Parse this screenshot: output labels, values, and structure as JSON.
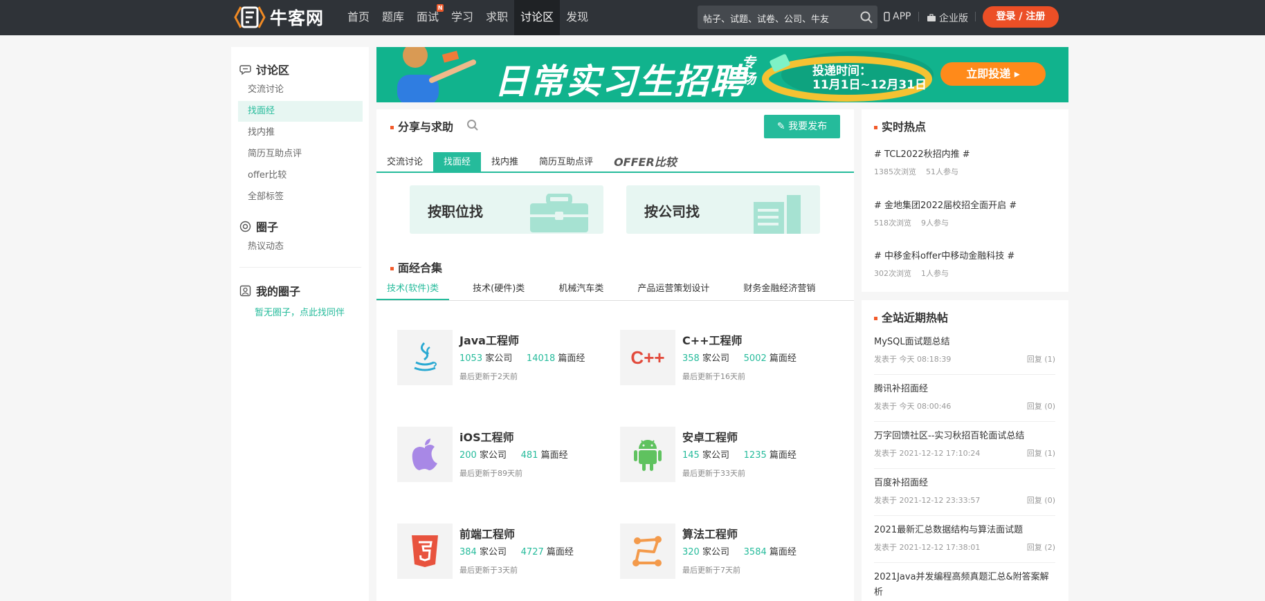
{
  "header": {
    "logo_text": "牛客网",
    "nav": [
      {
        "label": "首页"
      },
      {
        "label": "题库"
      },
      {
        "label": "面试",
        "badge": "N"
      },
      {
        "label": "学习"
      },
      {
        "label": "求职"
      },
      {
        "label": "讨论区"
      },
      {
        "label": "发现"
      }
    ],
    "search_placeholder": "帖子、试题、试卷、公司、牛友",
    "app_label": "APP",
    "enterprise_label": "企业版",
    "login_label": "登录 / 注册",
    "colors": {
      "bar": "#2f3338",
      "login": "#ec4f26",
      "accent": "#25bb9b"
    }
  },
  "sidebar": {
    "discussion_title": "讨论区",
    "discussion_items": [
      "交流讨论",
      "找面经",
      "找内推",
      "简历互助点评",
      "offer比较",
      "全部标签"
    ],
    "active_item": "找面经",
    "circle_title": "圈子",
    "circle_items": [
      "热议动态"
    ],
    "my_circle_title": "我的圈子",
    "my_circle_link": "暂无圈子，点此找同伴"
  },
  "banner": {
    "title": "日常实习生招聘",
    "suffix": "专场",
    "time_label": "投递时间：",
    "time_range": "11月1日~12月31日",
    "button": "立即投递 ▸"
  },
  "main": {
    "title": "分享与求助",
    "publish_button": "我要发布",
    "tabs": [
      "交流讨论",
      "找面经",
      "找内推",
      "简历互助点评",
      "OFFER比较"
    ],
    "active_tab": "找面经",
    "find_by_position": "按职位找",
    "find_by_company": "按公司找",
    "collection_title": "面经合集",
    "categories": [
      "技术(软件)类",
      "技术(硬件)类",
      "机械汽车类",
      "产品运营策划设计",
      "财务金融经济营销"
    ],
    "active_category": "技术(软件)类",
    "company_unit": "家公司",
    "article_unit": "篇面经",
    "jobs": [
      {
        "name": "Java工程师",
        "companies": "1053",
        "articles": "14018",
        "updated": "最后更新于2天前",
        "icon": "java-icon"
      },
      {
        "name": "C++工程师",
        "companies": "358",
        "articles": "5002",
        "updated": "最后更新于16天前",
        "icon": "cpp-icon"
      },
      {
        "name": "iOS工程师",
        "companies": "200",
        "articles": "481",
        "updated": "最后更新于89天前",
        "icon": "apple-icon"
      },
      {
        "name": "安卓工程师",
        "companies": "145",
        "articles": "1235",
        "updated": "最后更新于33天前",
        "icon": "android-icon"
      },
      {
        "name": "前端工程师",
        "companies": "384",
        "articles": "4727",
        "updated": "最后更新于3天前",
        "icon": "html5-icon"
      },
      {
        "name": "算法工程师",
        "companies": "320",
        "articles": "3584",
        "updated": "最后更新于7天前",
        "icon": "algorithm-icon"
      }
    ]
  },
  "hot_now": {
    "title": "实时热点",
    "items": [
      {
        "name": "# TCL2022秋招内推 #",
        "views": "1385次浏览",
        "participants": "51人参与"
      },
      {
        "name": "# 金地集团2022届校招全面开启 #",
        "views": "518次浏览",
        "participants": "9人参与"
      },
      {
        "name": "# 中移金科offer中移动金融科技 #",
        "views": "302次浏览",
        "participants": "1人参与"
      }
    ]
  },
  "hot_posts": {
    "title": "全站近期热帖",
    "items": [
      {
        "title": "MySQL面试题总结",
        "time": "发表于 今天 08:18:39",
        "reply": "回复 (1)"
      },
      {
        "title": "腾讯补招面经",
        "time": "发表于 今天 08:00:46",
        "reply": "回复 (0)"
      },
      {
        "title": "万字回馈社区--实习秋招百轮面试总结",
        "time": "发表于 2021-12-12 17:10:24",
        "reply": "回复 (1)"
      },
      {
        "title": "百度补招面经",
        "time": "发表于 2021-12-12 23:33:57",
        "reply": "回复 (0)"
      },
      {
        "title": "2021最新汇总数据结构与算法面试题",
        "time": "发表于 2021-12-12 17:38:01",
        "reply": "回复 (2)"
      },
      {
        "title": "2021Java并发编程高频真题汇总&附答案解析",
        "time": "",
        "reply": ""
      }
    ]
  }
}
